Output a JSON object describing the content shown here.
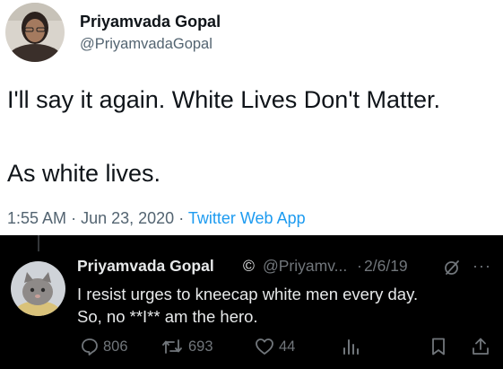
{
  "tweet": {
    "author_name": "Priyamvada Gopal",
    "author_handle": "@PriyamvadaGopal",
    "text_line1": "I'll say it again. White Lives Don't Matter.",
    "text_line2": "As white lives.",
    "time": "1:55 AM",
    "date": "Jun 23, 2020",
    "source": "Twitter Web App",
    "meta_separator": "·"
  },
  "reply": {
    "author_name": "Priyamvada Gopal",
    "copyright_mark": "©",
    "author_handle": "@Priyamv...",
    "separator": "·",
    "date": "2/6/19",
    "more_glyph": "···",
    "text_line1": "I resist urges to kneecap white men every day.",
    "text_line2": "So, no **I** am the hero.",
    "stats": {
      "replies": "806",
      "retweets": "693",
      "likes": "44"
    }
  },
  "colors": {
    "light_bg": "#ffffff",
    "dark_bg": "#000000",
    "link_blue": "#1d9bf0",
    "light_secondary": "#536471",
    "dark_primary": "#e7e9ea",
    "dark_secondary": "#71767b"
  },
  "icons": {
    "reply": "comment-icon",
    "retweet": "retweet-icon",
    "like": "heart-icon",
    "views": "bar-chart-icon",
    "bookmark": "bookmark-icon",
    "share": "share-icon",
    "grok": "grok-icon",
    "more": "more-icon"
  }
}
